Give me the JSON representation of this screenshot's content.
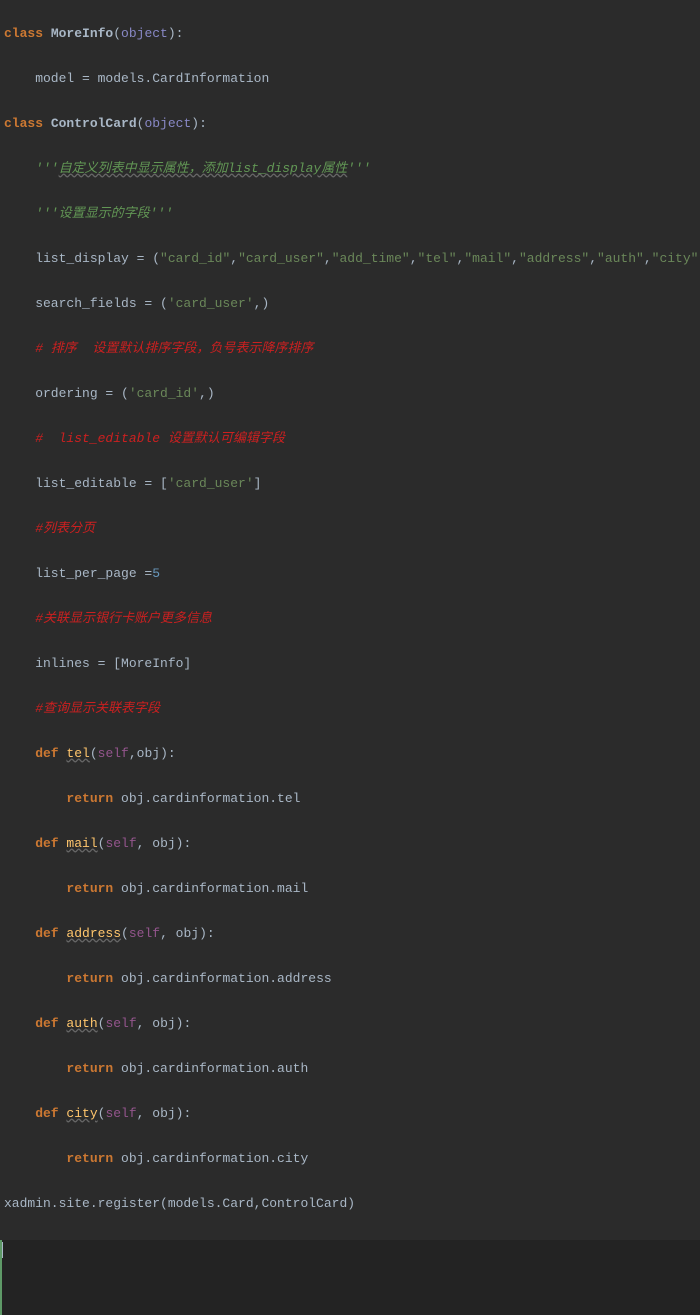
{
  "code": {
    "l1_class": "class ",
    "l1_name": "MoreInfo",
    "l1_open": "(",
    "l1_obj": "object",
    "l1_close": "):",
    "l2": "    model = models.CardInformation",
    "l3_class": "class ",
    "l3_name": "ControlCard",
    "l3_open": "(",
    "l3_obj": "object",
    "l3_close": "):",
    "l4_a": "    '''",
    "l4_b": "自定义列表中显示属性，添加list_display属性",
    "l4_c": "'''",
    "l5": "    '''设置显示的字段'''",
    "l6_a": "    list_display = (",
    "l6_s1": "\"card_id\"",
    "l6_c": ",",
    "l6_s2": "\"card_user\"",
    "l6_s3": "\"add_time\"",
    "l6_s4": "\"tel\"",
    "l6_s5": "\"mail\"",
    "l6_s6": "\"address\"",
    "l6_s7": "\"auth\"",
    "l6_s8": "\"city\"",
    "l6_end": ")",
    "l7_a": "    search_fields = (",
    "l7_s": "'card_user'",
    "l7_end": ",)",
    "l8": "    # 排序  设置默认排序字段，负号表示降序排序",
    "l9_a": "    ordering = (",
    "l9_s": "'card_id'",
    "l9_end": ",)",
    "l10": "    #  list_editable 设置默认可编辑字段",
    "l11_a": "    list_editable = [",
    "l11_s": "'card_user'",
    "l11_end": "]",
    "l12": "    #列表分页",
    "l13_a": "    list_per_page =",
    "l13_n": "5",
    "l14": "    #关联显示银行卡账户更多信息",
    "l15_a": "    inlines = [MoreInfo]",
    "l16": "    #查询显示关联表字段",
    "l17_def": "    def ",
    "l17_name": "tel",
    "l17_open": "(",
    "l17_self": "self",
    "l17_mid": ",obj):",
    "l18_ret": "        return ",
    "l18_rest": "obj.cardinformation.tel",
    "l19_def": "    def ",
    "l19_name": "mail",
    "l19_open": "(",
    "l19_self": "self",
    "l19_mid": ", obj):",
    "l20_ret": "        return ",
    "l20_rest": "obj.cardinformation.mail",
    "l21_def": "    def ",
    "l21_name": "address",
    "l21_open": "(",
    "l21_self": "self",
    "l21_mid": ", obj):",
    "l22_ret": "        return ",
    "l22_rest": "obj.cardinformation.address",
    "l23_def": "    def ",
    "l23_name": "auth",
    "l23_open": "(",
    "l23_self": "self",
    "l23_mid": ", obj):",
    "l24_ret": "        return ",
    "l24_rest": "obj.cardinformation.auth",
    "l25_def": "    def ",
    "l25_name": "city",
    "l25_open": "(",
    "l25_self": "self",
    "l25_mid": ", obj):",
    "l26_ret": "        return ",
    "l26_rest": "obj.cardinformation.city",
    "l27": "xadmin.site.register(models.Card,ControlCard)"
  }
}
